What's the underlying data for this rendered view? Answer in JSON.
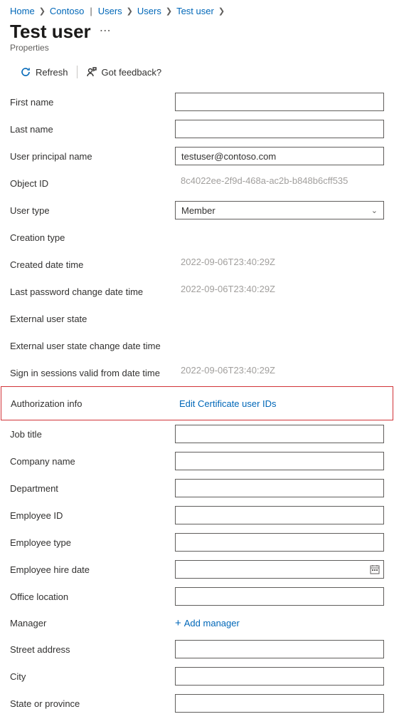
{
  "breadcrumb": {
    "home": "Home",
    "tenant": "Contoso",
    "level1": "Users",
    "level2": "Users",
    "level3": "Test user"
  },
  "page": {
    "title": "Test user",
    "subtitle": "Properties"
  },
  "commands": {
    "refresh": "Refresh",
    "feedback": "Got feedback?"
  },
  "fields": {
    "first_name": {
      "label": "First name",
      "value": ""
    },
    "last_name": {
      "label": "Last name",
      "value": ""
    },
    "upn": {
      "label": "User principal name",
      "value": "testuser@contoso.com"
    },
    "object_id": {
      "label": "Object ID",
      "value": "8c4022ee-2f9d-468a-ac2b-b848b6cff535"
    },
    "user_type": {
      "label": "User type",
      "value": "Member"
    },
    "creation_type": {
      "label": "Creation type",
      "value": ""
    },
    "created": {
      "label": "Created date time",
      "value": "2022-09-06T23:40:29Z"
    },
    "last_pwd": {
      "label": "Last password change date time",
      "value": "2022-09-06T23:40:29Z"
    },
    "ext_state": {
      "label": "External user state",
      "value": ""
    },
    "ext_state_dt": {
      "label": "External user state change date time",
      "value": ""
    },
    "signin_valid": {
      "label": "Sign in sessions valid from date time",
      "value": "2022-09-06T23:40:29Z"
    },
    "authz": {
      "label": "Authorization info",
      "link": "Edit Certificate user IDs"
    },
    "job_title": {
      "label": "Job title",
      "value": ""
    },
    "company": {
      "label": "Company name",
      "value": ""
    },
    "department": {
      "label": "Department",
      "value": ""
    },
    "employee_id": {
      "label": "Employee ID",
      "value": ""
    },
    "employee_type": {
      "label": "Employee type",
      "value": ""
    },
    "employee_hire": {
      "label": "Employee hire date",
      "value": ""
    },
    "office": {
      "label": "Office location",
      "value": ""
    },
    "manager": {
      "label": "Manager",
      "link": "Add manager"
    },
    "street": {
      "label": "Street address",
      "value": ""
    },
    "city": {
      "label": "City",
      "value": ""
    },
    "state": {
      "label": "State or province",
      "value": ""
    }
  }
}
